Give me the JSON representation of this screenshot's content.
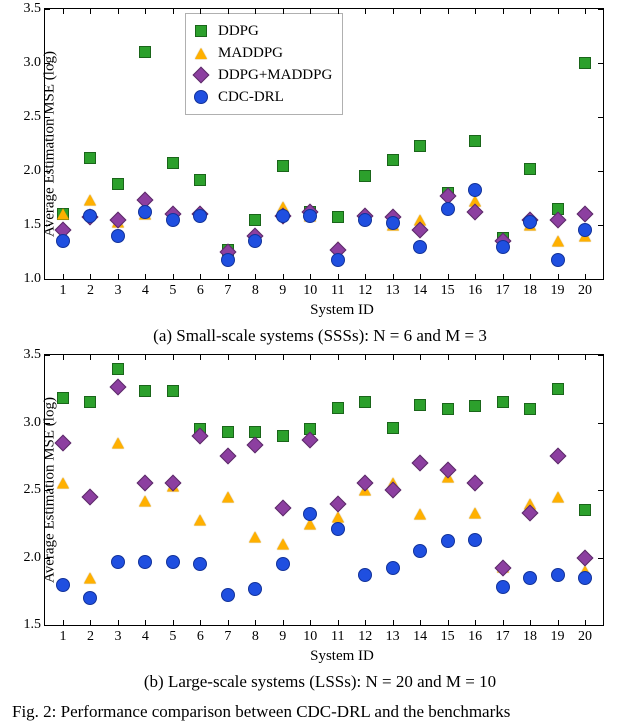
{
  "legend": {
    "ddpg": "DDPG",
    "maddpg": "MADDPG",
    "ddpg_maddpg": "DDPG+MADDPG",
    "cdc_drl": "CDC-DRL"
  },
  "axis": {
    "ylabel": "Average Estimation MSE (log)",
    "xlabel": "System ID"
  },
  "captions": {
    "a": "(a)   Small-scale systems (SSSs): N = 6 and M = 3",
    "b": "(b)   Large-scale systems (LSSs): N = 20 and M = 10",
    "fig": "Fig. 2:   Performance comparison between CDC-DRL and the benchmarks"
  },
  "chart_data": [
    {
      "id": "a",
      "type": "scatter",
      "xlabel": "System ID",
      "ylabel": "Average Estimation MSE (log)",
      "x": [
        1,
        2,
        3,
        4,
        5,
        6,
        7,
        8,
        9,
        10,
        11,
        12,
        13,
        14,
        15,
        16,
        17,
        18,
        19,
        20
      ],
      "ylim": [
        1.0,
        3.5
      ],
      "yticks": [
        1.0,
        1.5,
        2.0,
        2.5,
        3.0,
        3.5
      ],
      "series": [
        {
          "name": "DDPG",
          "marker": "square",
          "color": "#2ca02c",
          "values": [
            1.6,
            2.12,
            1.88,
            3.1,
            2.07,
            1.92,
            1.27,
            1.55,
            2.05,
            1.62,
            1.57,
            1.95,
            2.1,
            2.23,
            1.8,
            2.28,
            1.38,
            2.02,
            1.65,
            3.0
          ]
        },
        {
          "name": "MADDPG",
          "marker": "triangle",
          "color": "#ff7f0e",
          "values": [
            1.6,
            1.73,
            1.53,
            1.6,
            1.57,
            1.6,
            1.25,
            1.38,
            1.67,
            1.58,
            1.3,
            1.6,
            1.5,
            1.55,
            1.67,
            1.72,
            1.33,
            1.5,
            1.35,
            1.4
          ]
        },
        {
          "name": "DDPG+MADDPG",
          "marker": "diamond",
          "color": "#9467bd",
          "values": [
            1.45,
            1.57,
            1.55,
            1.73,
            1.6,
            1.6,
            1.25,
            1.4,
            1.58,
            1.62,
            1.27,
            1.58,
            1.57,
            1.45,
            1.77,
            1.62,
            1.35,
            1.55,
            1.55,
            1.6
          ]
        },
        {
          "name": "CDC-DRL",
          "marker": "circle",
          "color": "#1f4fe0",
          "values": [
            1.35,
            1.58,
            1.4,
            1.62,
            1.55,
            1.58,
            1.18,
            1.35,
            1.58,
            1.58,
            1.18,
            1.55,
            1.52,
            1.3,
            1.65,
            1.82,
            1.3,
            1.53,
            1.18,
            1.45
          ]
        }
      ]
    },
    {
      "id": "b",
      "type": "scatter",
      "xlabel": "System ID",
      "ylabel": "Average Estimation MSE (log)",
      "x": [
        1,
        2,
        3,
        4,
        5,
        6,
        7,
        8,
        9,
        10,
        11,
        12,
        13,
        14,
        15,
        16,
        17,
        18,
        19,
        20
      ],
      "ylim": [
        1.5,
        3.5
      ],
      "yticks": [
        1.5,
        2.0,
        2.5,
        3.0,
        3.5
      ],
      "series": [
        {
          "name": "DDPG",
          "marker": "square",
          "color": "#2ca02c",
          "values": [
            3.18,
            3.15,
            3.4,
            3.23,
            3.23,
            2.95,
            2.93,
            2.93,
            2.9,
            2.95,
            3.11,
            3.15,
            2.96,
            3.13,
            3.1,
            3.12,
            3.15,
            3.1,
            3.25,
            2.35
          ]
        },
        {
          "name": "MADDPG",
          "marker": "triangle",
          "color": "#ff7f0e",
          "values": [
            2.55,
            1.85,
            2.85,
            2.42,
            2.53,
            2.28,
            2.45,
            2.15,
            2.1,
            2.25,
            2.3,
            2.5,
            2.55,
            2.32,
            2.6,
            2.33,
            1.93,
            2.4,
            2.45,
            1.9
          ]
        },
        {
          "name": "DDPG+MADDPG",
          "marker": "diamond",
          "color": "#9467bd",
          "values": [
            2.85,
            2.45,
            3.26,
            2.55,
            2.55,
            2.9,
            2.75,
            2.83,
            2.37,
            2.87,
            2.4,
            2.55,
            2.5,
            2.7,
            2.65,
            2.55,
            1.92,
            2.33,
            2.75,
            2.0
          ]
        },
        {
          "name": "CDC-DRL",
          "marker": "circle",
          "color": "#1f4fe0",
          "values": [
            1.8,
            1.7,
            1.97,
            1.97,
            1.97,
            1.95,
            1.72,
            1.77,
            1.95,
            2.32,
            2.21,
            1.87,
            1.92,
            2.05,
            2.12,
            2.13,
            1.78,
            1.85,
            1.87,
            1.85
          ]
        }
      ]
    }
  ]
}
